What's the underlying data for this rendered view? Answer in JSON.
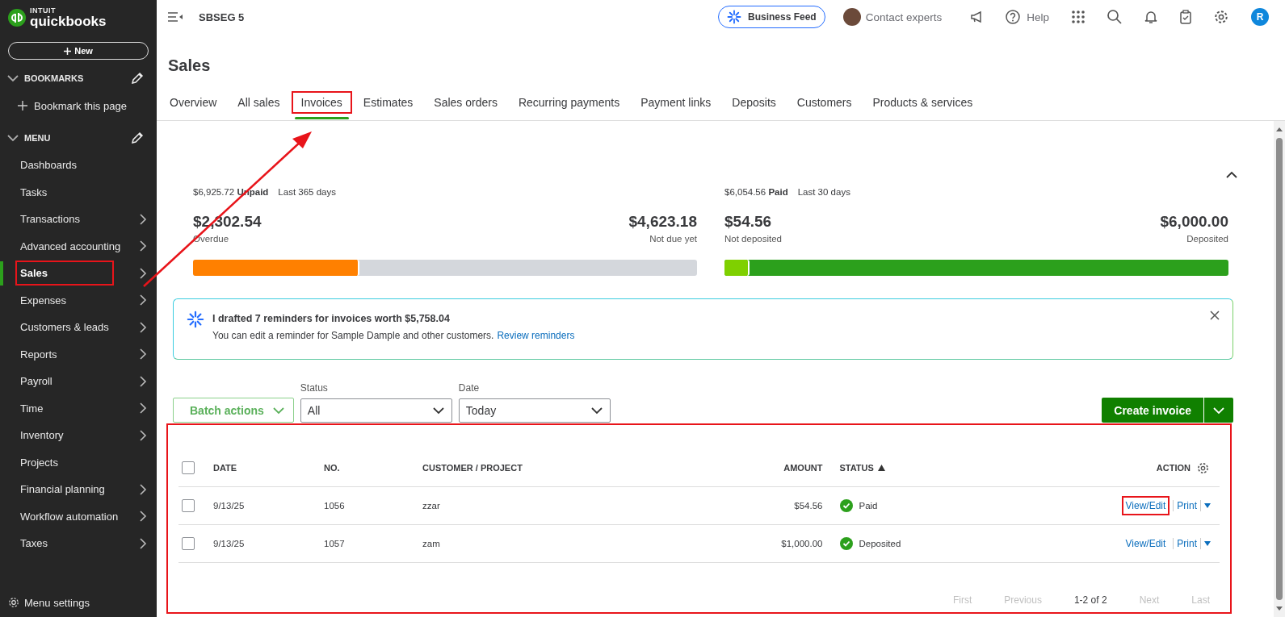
{
  "sidebar": {
    "brand_top": "INTUIT",
    "brand": "quickbooks",
    "new_button": "New",
    "bookmarks": {
      "title": "BOOKMARKS",
      "expanded": true,
      "items": [
        "Bookmark this page"
      ]
    },
    "menu": {
      "title": "MENU",
      "expanded": true,
      "items": [
        {
          "label": "Dashboards",
          "has_submenu": false,
          "selected": false,
          "highlighted": false
        },
        {
          "label": "Tasks",
          "has_submenu": false,
          "selected": false,
          "highlighted": false
        },
        {
          "label": "Transactions",
          "has_submenu": true,
          "selected": false,
          "highlighted": false
        },
        {
          "label": "Advanced accounting",
          "has_submenu": true,
          "selected": false,
          "highlighted": false
        },
        {
          "label": "Sales",
          "has_submenu": true,
          "selected": true,
          "highlighted": true
        },
        {
          "label": "Expenses",
          "has_submenu": true,
          "selected": false,
          "highlighted": false
        },
        {
          "label": "Customers & leads",
          "has_submenu": true,
          "selected": false,
          "highlighted": false
        },
        {
          "label": "Reports",
          "has_submenu": true,
          "selected": false,
          "highlighted": false
        },
        {
          "label": "Payroll",
          "has_submenu": true,
          "selected": false,
          "highlighted": false
        },
        {
          "label": "Time",
          "has_submenu": true,
          "selected": false,
          "highlighted": false
        },
        {
          "label": "Inventory",
          "has_submenu": true,
          "selected": false,
          "highlighted": false
        },
        {
          "label": "Projects",
          "has_submenu": false,
          "selected": false,
          "highlighted": false
        },
        {
          "label": "Financial planning",
          "has_submenu": true,
          "selected": false,
          "highlighted": false
        },
        {
          "label": "Workflow automation",
          "has_submenu": true,
          "selected": false,
          "highlighted": false
        },
        {
          "label": "Taxes",
          "has_submenu": true,
          "selected": false,
          "highlighted": false
        }
      ]
    },
    "settings": "Menu settings"
  },
  "top_bar": {
    "company": "SBSEG 5",
    "business_feed": "Business Feed",
    "contact": "Contact experts",
    "help": "Help",
    "user_initial": "R"
  },
  "page": {
    "title": "Sales",
    "tabs": [
      {
        "label": "Overview",
        "selected": false,
        "highlighted": false
      },
      {
        "label": "All sales",
        "selected": false,
        "highlighted": false
      },
      {
        "label": "Invoices",
        "selected": true,
        "highlighted": true
      },
      {
        "label": "Estimates",
        "selected": false,
        "highlighted": false
      },
      {
        "label": "Sales orders",
        "selected": false,
        "highlighted": false
      },
      {
        "label": "Recurring payments",
        "selected": false,
        "highlighted": false
      },
      {
        "label": "Payment links",
        "selected": false,
        "highlighted": false
      },
      {
        "label": "Deposits",
        "selected": false,
        "highlighted": false
      },
      {
        "label": "Customers",
        "selected": false,
        "highlighted": false
      },
      {
        "label": "Products & services",
        "selected": false,
        "highlighted": false
      }
    ]
  },
  "summaries": [
    {
      "total": "$6,925.72",
      "total_label": "Unpaid",
      "period": "Last 365 days",
      "left_amount": "$2,302.54",
      "left_label": "Overdue",
      "right_amount": "$4,623.18",
      "right_label": "Not due yet",
      "level": 0.33,
      "kind": "unpaid"
    },
    {
      "total": "$6,054.56",
      "total_label": "Paid",
      "period": "Last 30 days",
      "left_amount": "$54.56",
      "left_label": "Not deposited",
      "right_amount": "$6,000.00",
      "right_label": "Deposited",
      "level": 0.05,
      "kind": "paid"
    }
  ],
  "banner": {
    "title": "I drafted 7 reminders for invoices worth $5,758.04",
    "text": "You can edit a reminder for Sample Dample and other customers.",
    "link": "Review reminders"
  },
  "filters": {
    "batch_actions": "Batch actions",
    "status": {
      "label": "Status",
      "value": "All"
    },
    "date": {
      "label": "Date",
      "value": "Today"
    },
    "create": "Create invoice"
  },
  "table": {
    "highlighted": true,
    "all_checked": false,
    "columns": [
      {
        "label": "DATE",
        "sorted": false
      },
      {
        "label": "NO.",
        "sorted": false
      },
      {
        "label": "CUSTOMER / PROJECT",
        "sorted": false
      },
      {
        "label": "AMOUNT",
        "sorted": false
      },
      {
        "label": "STATUS",
        "sorted": true
      },
      {
        "label": "ACTION",
        "sorted": false
      }
    ],
    "rows": [
      {
        "checked": false,
        "date": "9/13/25",
        "no": "1056",
        "customer": "zzar",
        "amount": "$54.56",
        "status": "Paid",
        "view_edit": "View/Edit",
        "print": "Print",
        "highlighted": true
      },
      {
        "checked": false,
        "date": "9/13/25",
        "no": "1057",
        "customer": "zam",
        "amount": "$1,000.00",
        "status": "Deposited",
        "view_edit": "View/Edit",
        "print": "Print",
        "highlighted": false
      }
    ],
    "pagination": {
      "first": "First",
      "previous": "Previous",
      "range": "1-2 of 2",
      "next": "Next",
      "last": "Last"
    }
  },
  "annotation_arrow": true
}
